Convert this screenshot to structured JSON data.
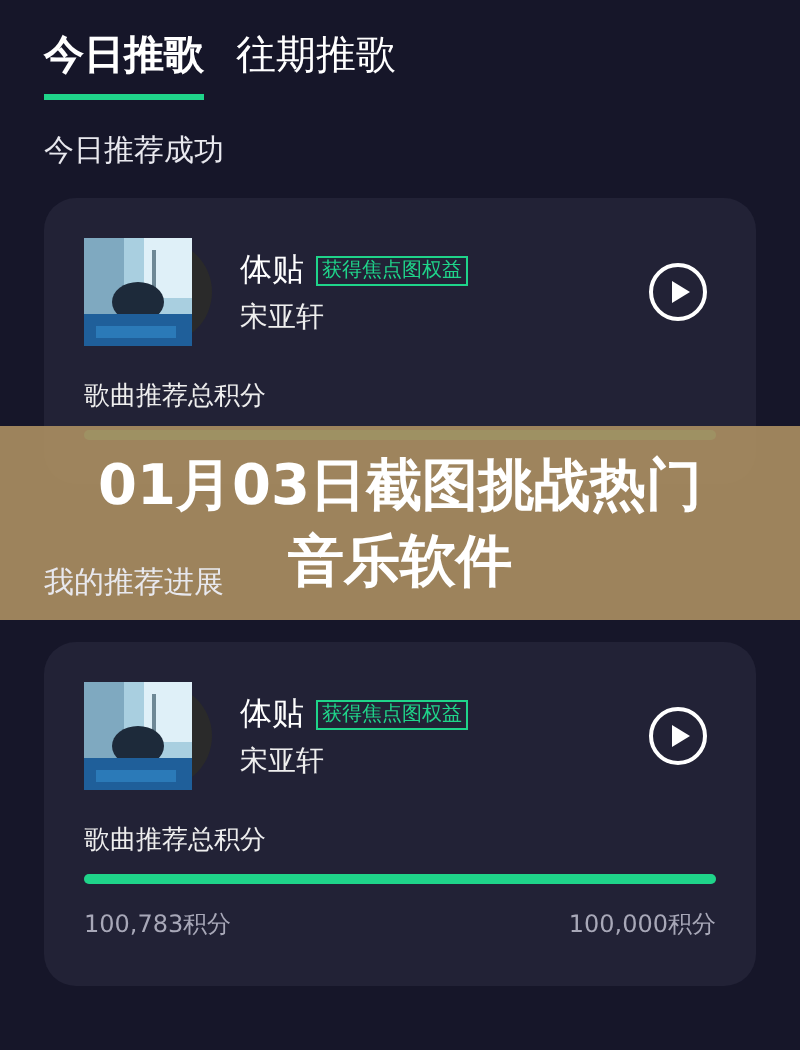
{
  "tabs": [
    {
      "label": "今日推歌",
      "selected": true
    },
    {
      "label": "往期推歌",
      "selected": false
    }
  ],
  "sections": [
    {
      "title": "今日推荐成功",
      "card": {
        "song": "体贴",
        "badge": "获得焦点图权益",
        "artist": "宋亚轩",
        "score_label": "歌曲推荐总积分",
        "level": 1
      }
    },
    {
      "title": "我的推荐进展",
      "card": {
        "song": "体贴",
        "badge": "获得焦点图权益",
        "artist": "宋亚轩",
        "score_label": "歌曲推荐总积分",
        "level": 1,
        "current": "100,783积分",
        "target": "100,000积分"
      }
    }
  ],
  "banner": {
    "lines": [
      "01月03日截图挑战热门",
      "音乐软件"
    ]
  }
}
